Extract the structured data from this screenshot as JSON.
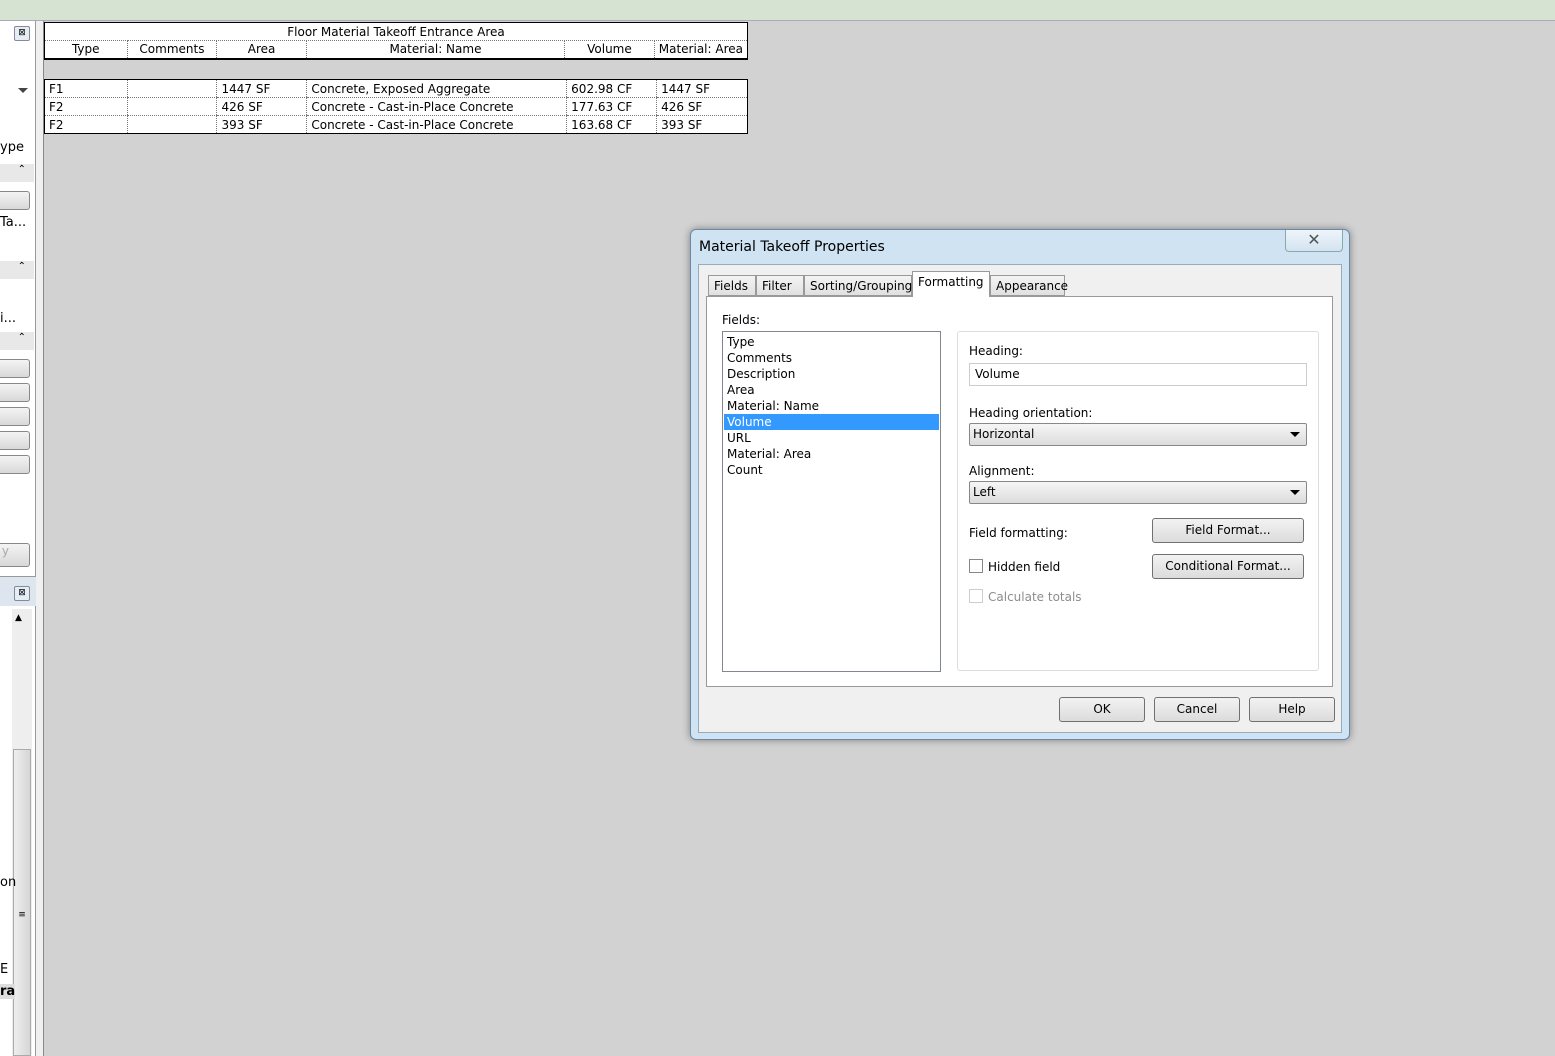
{
  "left_panel": {
    "text1": "ype",
    "text2": "Ta...",
    "text3": "i...",
    "text4": "y",
    "text5": "on",
    "text6": "E",
    "text7": "ra"
  },
  "schedule": {
    "title": "Floor Material Takeoff Entrance Area",
    "columns": [
      "Type",
      "Comments",
      "Area",
      "Material: Name",
      "Volume",
      "Material: Area"
    ],
    "rows": [
      [
        "F1",
        "",
        "1447 SF",
        "Concrete, Exposed Aggregate",
        "602.98 CF",
        "1447 SF"
      ],
      [
        "F2",
        "",
        "426 SF",
        "Concrete - Cast-in-Place Concrete",
        "177.63 CF",
        "426 SF"
      ],
      [
        "F2",
        "",
        "393 SF",
        "Concrete - Cast-in-Place Concrete",
        "163.68 CF",
        "393 SF"
      ]
    ]
  },
  "dialog": {
    "title": "Material Takeoff Properties",
    "close": "✕",
    "tabs": [
      "Fields",
      "Filter",
      "Sorting/Grouping",
      "Formatting",
      "Appearance"
    ],
    "active_tab": "Formatting",
    "fields_label": "Fields:",
    "fields": [
      "Type",
      "Comments",
      "Description",
      "Area",
      "Material: Name",
      "Volume",
      "URL",
      "Material: Area",
      "Count"
    ],
    "selected_field": "Volume",
    "heading_label": "Heading:",
    "heading_value": "Volume",
    "orientation_label": "Heading orientation:",
    "orientation_value": "Horizontal",
    "alignment_label": "Alignment:",
    "alignment_value": "Left",
    "field_formatting_label": "Field formatting:",
    "field_format_button": "Field Format...",
    "hidden_field_label": "Hidden field",
    "conditional_format_button": "Conditional  Format...",
    "calculate_totals_label": "Calculate totals",
    "ok": "OK",
    "cancel": "Cancel",
    "help": "Help"
  }
}
